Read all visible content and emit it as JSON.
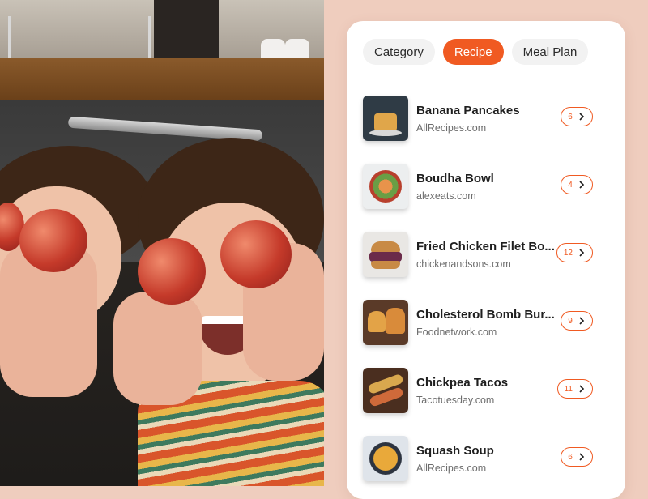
{
  "tabs": [
    {
      "label": "Category",
      "active": false
    },
    {
      "label": "Recipe",
      "active": true
    },
    {
      "label": "Meal Plan",
      "active": false
    }
  ],
  "recipes": [
    {
      "title": "Banana Pancakes",
      "source": "AllRecipes.com",
      "count": "6"
    },
    {
      "title": "Boudha Bowl",
      "source": "alexeats.com",
      "count": "4"
    },
    {
      "title": "Fried Chicken Filet Bo...",
      "source": "chickenandsons.com",
      "count": "12"
    },
    {
      "title": "Cholesterol Bomb Bur...",
      "source": "Foodnetwork.com",
      "count": "9"
    },
    {
      "title": "Chickpea Tacos",
      "source": "Tacotuesday.com",
      "count": "11"
    },
    {
      "title": "Squash Soup",
      "source": "AllRecipes.com",
      "count": "6"
    }
  ],
  "icons": {
    "row_action": "chevron-right-icon"
  },
  "colors": {
    "accent": "#f05a22",
    "background": "#efcdbe",
    "card": "#ffffff"
  }
}
